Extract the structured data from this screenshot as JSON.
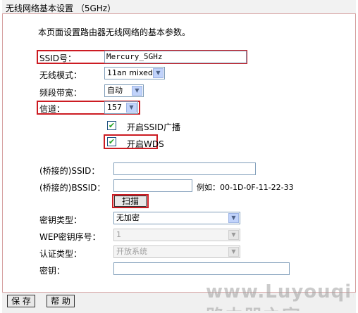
{
  "title": "无线网络基本设置 （5GHz）",
  "intro": "本页面设置路由器无线网络的基本参数。",
  "colors": {
    "highlight": "#cc1b22",
    "title_bg": "#f2f2f2",
    "check": "#21a121"
  },
  "fields": {
    "ssid": {
      "label": "SSID号：",
      "value": "Mercury_5GHz"
    },
    "mode": {
      "label": "无线模式：",
      "value": "11an mixed"
    },
    "bandwidth": {
      "label": "频段带宽：",
      "value": "自动"
    },
    "channel": {
      "label": "信道：",
      "value": "157"
    },
    "ssid_broadcast": {
      "label": "开启SSID广播",
      "checked": true
    },
    "wds": {
      "label": "开启WDS",
      "checked": true
    },
    "bridge_ssid": {
      "label": "(桥接的)SSID：",
      "value": ""
    },
    "bridge_bssid": {
      "label": "(桥接的)BSSID：",
      "value": "",
      "example": "例如：00-1D-0F-11-22-33"
    },
    "scan_button": "扫描",
    "key_type": {
      "label": "密钥类型：",
      "value": "无加密"
    },
    "wep_index": {
      "label": "WEP密钥序号：",
      "value": "1"
    },
    "auth_type": {
      "label": "认证类型：",
      "value": "开放系统"
    },
    "key": {
      "label": "密钥：",
      "value": ""
    }
  },
  "buttons": {
    "save": "保 存",
    "help": "帮 助"
  },
  "watermark": "www.Luyouqi.com 路由器之家"
}
